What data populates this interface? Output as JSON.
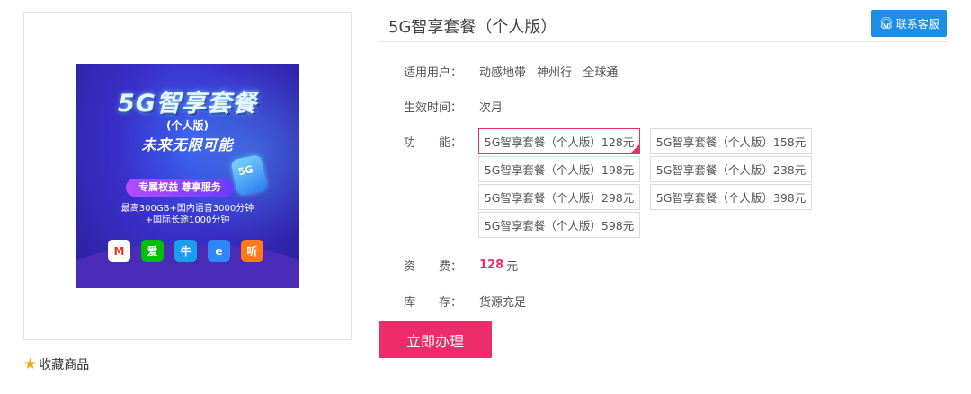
{
  "poster": {
    "title": "5G智享套餐",
    "subtitle": "(个人版)",
    "slogan": "未来无限可能",
    "ribbon": "专属权益 尊享服务",
    "desc_line1": "最高300GB+国内语音3000分钟",
    "desc_line2": "+国际长途1000分钟",
    "badge": "5G",
    "apps": [
      "M",
      "爱",
      "牛",
      "e",
      "听"
    ]
  },
  "favorite": {
    "label": "收藏商品",
    "icon": "star-icon"
  },
  "product": {
    "title": "5G智享套餐（个人版）",
    "service_button": "联系客服",
    "service_icon": "headset-icon",
    "labels": {
      "users": "适用用户：",
      "effective": "生效时间：",
      "function": "功　　能：",
      "price": "资　　费：",
      "stock": "库　　存："
    },
    "users": [
      "动感地带",
      "神州行",
      "全球通"
    ],
    "effective_time": "次月",
    "options": [
      "5G智享套餐（个人版）128元",
      "5G智享套餐（个人版）158元",
      "5G智享套餐（个人版）198元",
      "5G智享套餐（个人版）238元",
      "5G智享套餐（个人版）298元",
      "5G智享套餐（个人版）398元",
      "5G智享套餐（个人版）598元"
    ],
    "selected_option_index": 0,
    "price_value": "128",
    "price_unit": "元",
    "stock": "货源充足",
    "buy_button": "立即办理"
  },
  "colors": {
    "accent": "#e8306e",
    "buy_button": "#ec2c6b",
    "service_button": "#1d8ee6"
  }
}
